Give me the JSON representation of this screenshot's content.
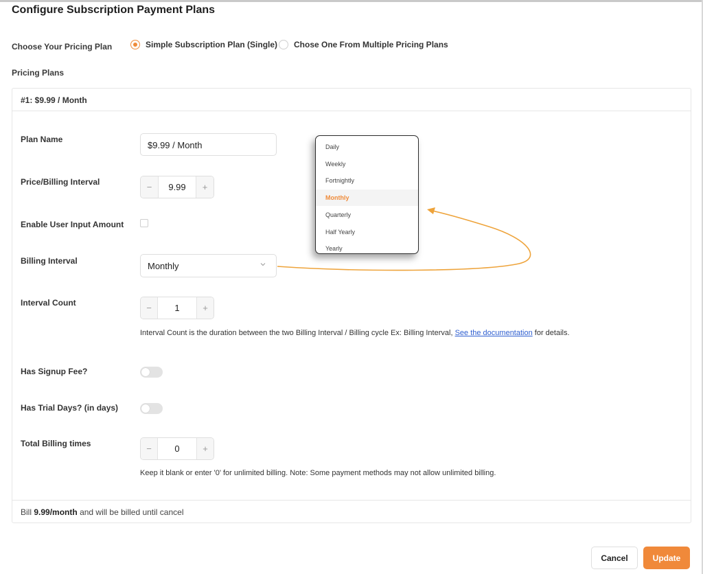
{
  "modal": {
    "title": "Configure Subscription Payment Plans"
  },
  "pricing_choice": {
    "label": "Choose Your Pricing Plan",
    "options": [
      "Simple Subscription Plan (Single)",
      "Chose One From Multiple Pricing Plans"
    ],
    "selected": "Simple Subscription Plan (Single)"
  },
  "pricing_plans": {
    "section_label": "Pricing Plans",
    "plan_header": "#1: $9.99 / Month",
    "fields": {
      "plan_name_label": "Plan Name",
      "plan_name_value": "$9.99 / Month",
      "price_label": "Price/Billing Interval",
      "price_value": "9.99",
      "user_input_label": "Enable User Input Amount",
      "billing_interval_label": "Billing Interval",
      "billing_interval_value": "Monthly",
      "interval_count_label": "Interval Count",
      "interval_count_value": "1",
      "interval_help_prefix": "Interval Count is the duration between the two Billing Interval / Billing cycle Ex: Billing Interval,",
      "interval_help_link": "See the documentation",
      "interval_help_suffix": "for details.",
      "signup_fee_label": "Has Signup Fee?",
      "trial_days_label": "Has Trial Days? (in days)",
      "total_billing_label": "Total Billing times",
      "total_billing_value": "0",
      "total_billing_help": "Keep it blank or enter '0' for unlimited billing. Note: Some payment methods may not allow unlimited billing."
    },
    "footer": {
      "prefix": "Bill",
      "amount": "9.99/month",
      "suffix": "and will be billed until cancel"
    }
  },
  "billing_interval_dropdown": {
    "options": [
      "Daily",
      "Weekly",
      "Fortnightly",
      "Monthly",
      "Quarterly",
      "Half Yearly",
      "Yearly"
    ],
    "selected": "Monthly"
  },
  "actions": {
    "cancel": "Cancel",
    "update": "Update"
  },
  "colors": {
    "accent": "#f0893a",
    "link": "#2f5fd0",
    "annotation_arrow": "#eea33a"
  },
  "icons": [
    "minus-icon",
    "plus-icon",
    "chevron-down-icon",
    "annotation-arrow"
  ]
}
